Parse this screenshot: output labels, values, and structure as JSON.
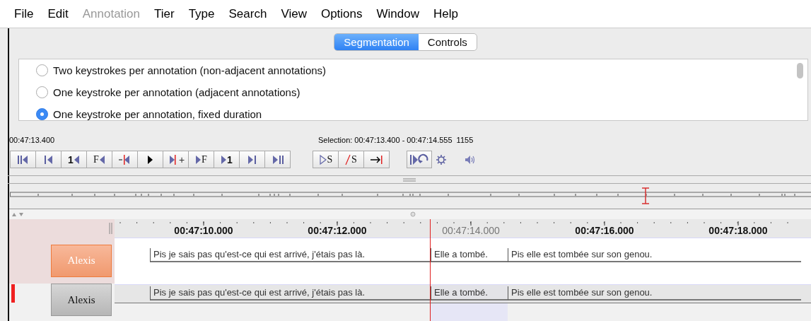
{
  "menu": [
    {
      "label": "File",
      "disabled": false
    },
    {
      "label": "Edit",
      "disabled": false
    },
    {
      "label": "Annotation",
      "disabled": true
    },
    {
      "label": "Tier",
      "disabled": false
    },
    {
      "label": "Type",
      "disabled": false
    },
    {
      "label": "Search",
      "disabled": false
    },
    {
      "label": "View",
      "disabled": false
    },
    {
      "label": "Options",
      "disabled": false
    },
    {
      "label": "Window",
      "disabled": false
    },
    {
      "label": "Help",
      "disabled": false
    }
  ],
  "tabs": [
    {
      "label": "Segmentation",
      "selected": true
    },
    {
      "label": "Controls",
      "selected": false
    }
  ],
  "options": [
    {
      "label": "Two keystrokes per annotation (non-adjacent annotations)",
      "selected": false
    },
    {
      "label": "One keystroke per annotation (adjacent annotations)",
      "selected": false
    },
    {
      "label": "One keystroke per annotation, fixed duration",
      "selected": true
    }
  ],
  "player": {
    "time": "00:47:13.400",
    "selection": "Selection: 00:47:13.400 - 00:47:14.555",
    "duration": "1155",
    "buttons": [
      {
        "kind": "go-begin"
      },
      {
        "kind": "prev-pixel"
      },
      {
        "kind": "prev-step",
        "text": "1"
      },
      {
        "kind": "prev-frame",
        "text": "F"
      },
      {
        "kind": "prev-boundary"
      },
      {
        "kind": "play"
      },
      {
        "kind": "next-boundary",
        "text": "+"
      },
      {
        "kind": "next-frame",
        "text": "F"
      },
      {
        "kind": "next-step",
        "text": "1"
      },
      {
        "kind": "next-pixel"
      },
      {
        "kind": "go-end"
      }
    ],
    "selection_buttons": [
      {
        "kind": "play-selection",
        "text": "S"
      },
      {
        "kind": "clear-selection",
        "text": "S"
      },
      {
        "kind": "to-selection-end"
      }
    ]
  },
  "timeline": {
    "ruler": [
      {
        "label": "00:47:10.000",
        "dimmed": false
      },
      {
        "label": "00:47:12.000",
        "dimmed": false
      },
      {
        "label": "00:47:14.000",
        "dimmed": true
      },
      {
        "label": "00:47:16.000",
        "dimmed": false
      },
      {
        "label": "00:47:18.000",
        "dimmed": false
      }
    ],
    "tiers": [
      {
        "name": "Alexis",
        "active": true,
        "marked": false,
        "annotations": [
          "Pis je sais pas qu'est-ce qui est arrivé, j'étais pas là.",
          "Elle a tombé.",
          "Pis elle est tombée sur son genou."
        ]
      },
      {
        "name": "Alexis",
        "active": false,
        "marked": true,
        "annotations": [
          "Pis je sais pas qu'est-ce qui est arrivé, j'étais pas là.",
          "Elle a tombé.",
          "Pis elle est tombée sur son genou."
        ]
      }
    ]
  }
}
